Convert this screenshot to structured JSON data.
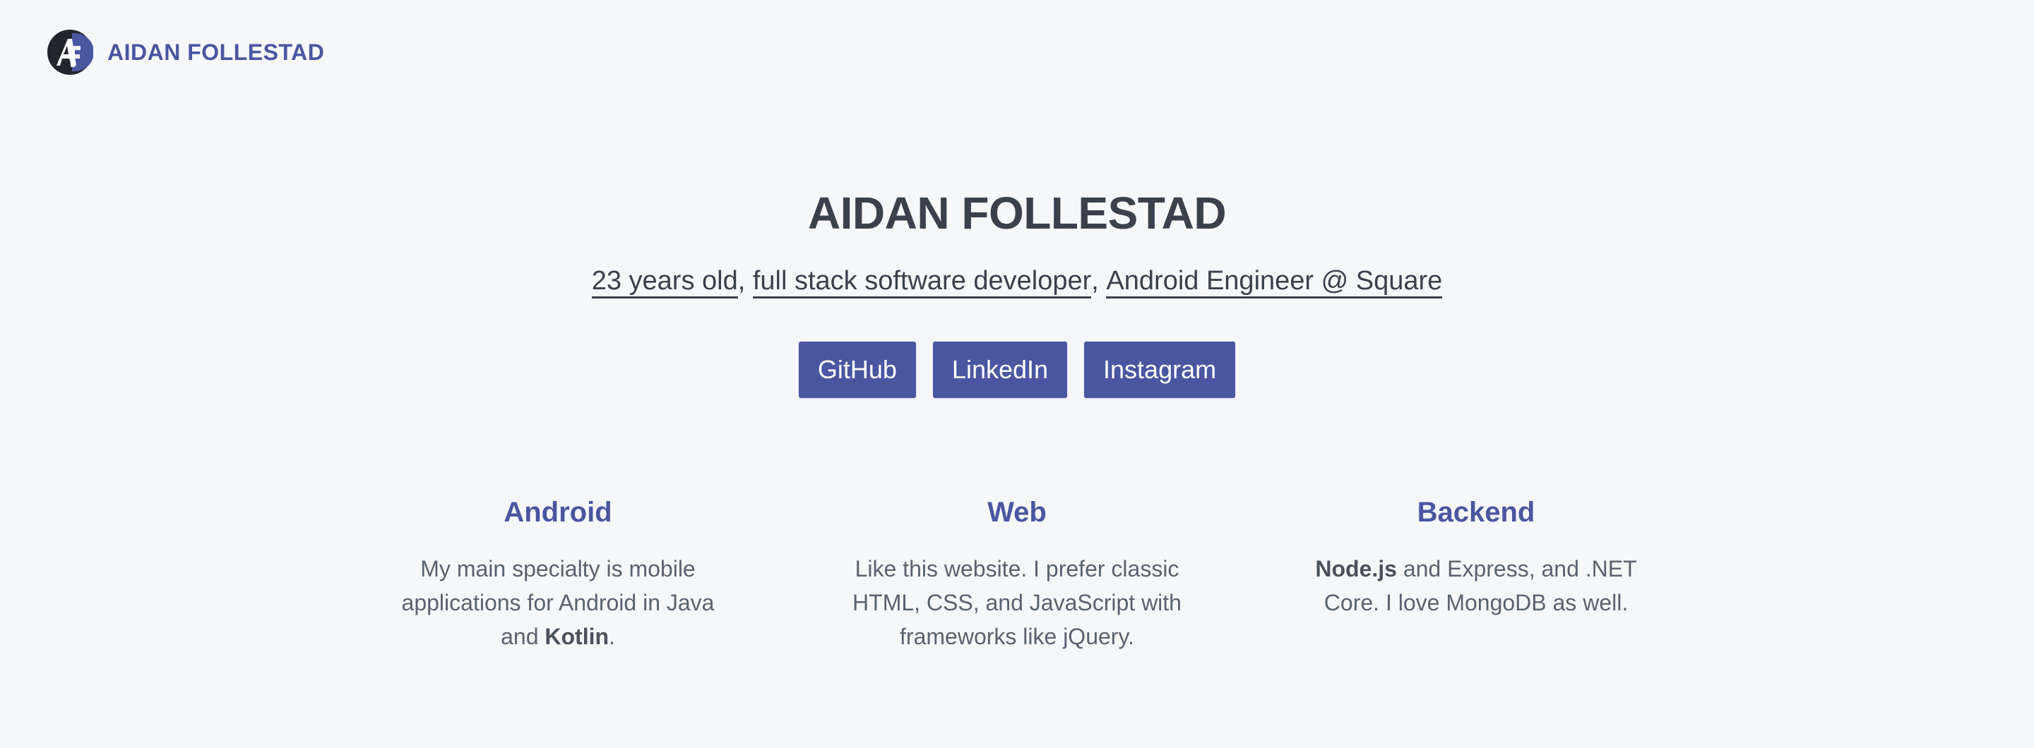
{
  "header": {
    "brand": "AIDAN FOLLESTAD",
    "logo_icon": "af-monogram-logo"
  },
  "hero": {
    "title": "AIDAN FOLLESTAD",
    "tags": [
      "23 years old",
      "full stack software developer",
      "Android Engineer @ Square"
    ],
    "separator": ",",
    "buttons": [
      "GitHub",
      "LinkedIn",
      "Instagram"
    ]
  },
  "skills": [
    {
      "title": "Android",
      "text_before": "My main specialty is mobile applications for Android in Java and ",
      "bold": "Kotlin",
      "text_after": "."
    },
    {
      "title": "Web",
      "text_before": "Like this website. I prefer classic HTML, CSS, and JavaScript with frameworks like jQuery.",
      "bold": "",
      "text_after": ""
    },
    {
      "title": "Backend",
      "bold_first": "Node.js",
      "text_after": " and Express, and .NET Core. I love MongoDB as well."
    }
  ],
  "colors": {
    "accent": "#4a56a0",
    "background": "#f6f7f9",
    "text": "#3a404c",
    "muted_text": "#5a6270"
  }
}
